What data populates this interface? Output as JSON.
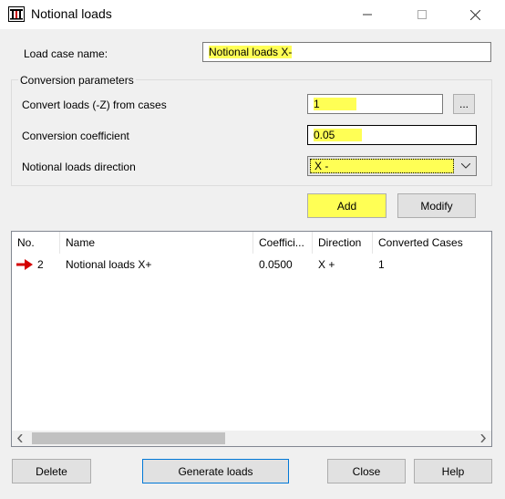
{
  "window": {
    "title": "Notional loads"
  },
  "form": {
    "load_case_label": "Load case name:",
    "load_case_value": "Notional loads X-",
    "group_title": "Conversion parameters",
    "convert_label": "Convert loads (-Z) from cases",
    "convert_value": "1",
    "browse_label": "...",
    "coefficient_label": "Conversion coefficient",
    "coefficient_value": "0.05",
    "direction_label": "Notional loads direction",
    "direction_value": "X -"
  },
  "actions": {
    "add": "Add",
    "modify": "Modify"
  },
  "table": {
    "columns": [
      "No.",
      "Name",
      "Coeffici...",
      "Direction",
      "Converted Cases"
    ],
    "rows": [
      {
        "no": "2",
        "name": "Notional loads X+",
        "coefficient": "0.0500",
        "direction": "X +",
        "converted_cases": "1"
      }
    ]
  },
  "footer": {
    "delete": "Delete",
    "generate": "Generate loads",
    "close": "Close",
    "help": "Help"
  },
  "colors": {
    "highlight": "#ffff55",
    "row_arrow": "#d40000",
    "default_button_border": "#0078d7"
  }
}
